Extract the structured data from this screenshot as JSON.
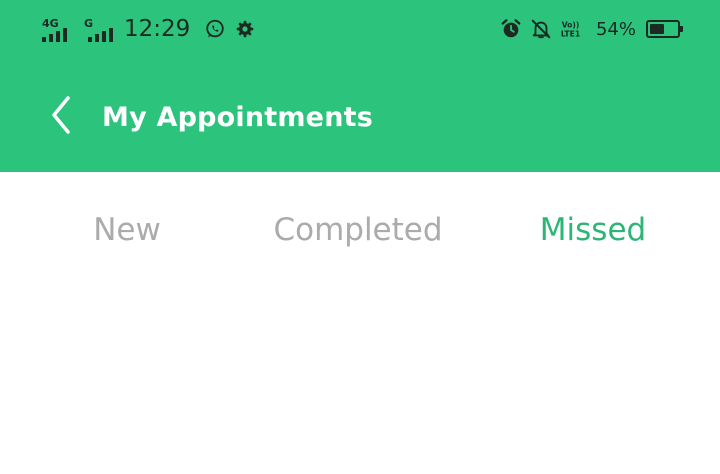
{
  "status_bar": {
    "network_primary": "4G",
    "network_secondary": "G",
    "time": "12:29",
    "volte_label_top": "Vo))",
    "volte_label_bottom": "LTE1",
    "battery_percent": "54%",
    "battery_level": 0.54,
    "icons": [
      "whatsapp-icon",
      "settings-icon",
      "alarm-icon",
      "notifications-off-icon",
      "volte-icon",
      "battery-icon"
    ]
  },
  "app_bar": {
    "title": "My Appointments",
    "back_icon": "chevron-left-icon"
  },
  "tabs": [
    {
      "label": "New",
      "active": false
    },
    {
      "label": "Completed",
      "active": false
    },
    {
      "label": "Missed",
      "active": true
    }
  ],
  "colors": {
    "header_green": "#2cc37d",
    "active_tab": "#2cb676",
    "inactive_tab": "#ababab",
    "title_text": "#ffffff"
  }
}
